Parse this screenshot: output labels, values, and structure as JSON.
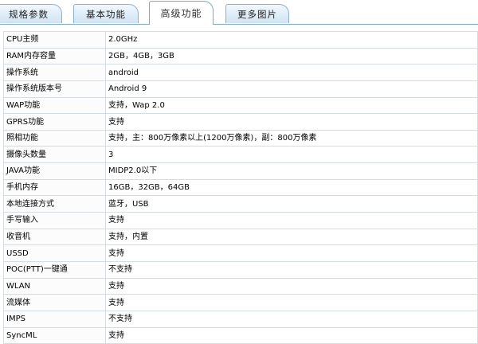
{
  "tabs": [
    {
      "label": "规格参数",
      "active": false
    },
    {
      "label": "基本功能",
      "active": false
    },
    {
      "label": "高级功能",
      "active": true
    },
    {
      "label": "更多图片",
      "active": false
    }
  ],
  "specs": [
    {
      "key": "CPU主频",
      "value": "2.0GHz"
    },
    {
      "key": "RAM内存容量",
      "value": "2GB，4GB，3GB"
    },
    {
      "key": "操作系统",
      "value": "android"
    },
    {
      "key": "操作系统版本号",
      "value": "Android 9"
    },
    {
      "key": "WAP功能",
      "value": "支持，Wap 2.0"
    },
    {
      "key": "GPRS功能",
      "value": "支持"
    },
    {
      "key": "照相功能",
      "value": "支持，主：800万像素以上(1200万像素)，副：800万像素"
    },
    {
      "key": "摄像头数量",
      "value": "3"
    },
    {
      "key": "JAVA功能",
      "value": "MIDP2.0以下"
    },
    {
      "key": "手机内存",
      "value": "16GB，32GB，64GB"
    },
    {
      "key": "本地连接方式",
      "value": "蓝牙，USB"
    },
    {
      "key": "手写输入",
      "value": "支持"
    },
    {
      "key": "收音机",
      "value": "支持，内置"
    },
    {
      "key": "USSD",
      "value": "支持"
    },
    {
      "key": "POC(PTT)一键通",
      "value": "不支持"
    },
    {
      "key": "WLAN",
      "value": "支持"
    },
    {
      "key": "流媒体",
      "value": "支持"
    },
    {
      "key": "IMPS",
      "value": "不支持"
    },
    {
      "key": "SyncML",
      "value": "支持"
    }
  ]
}
